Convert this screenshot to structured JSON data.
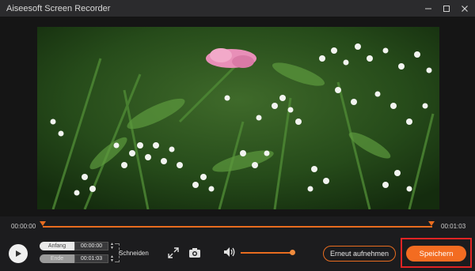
{
  "window": {
    "title": "Aiseesoft Screen Recorder",
    "controls": [
      "minimize-icon",
      "maximize-icon",
      "close-icon"
    ]
  },
  "preview": {
    "description_icon": "video-frame"
  },
  "timeline": {
    "start_time": "00:00:00",
    "end_time": "00:01:03",
    "accent": "#e86c1f"
  },
  "clip": {
    "start_label": "Anfang",
    "start_value": "00:00:00",
    "end_label": "Ende",
    "end_value": "00:01:03",
    "cut_label": "Schneiden"
  },
  "toolbar": {
    "play_icon": "play-icon",
    "expand_icon": "expand-icon",
    "camera_icon": "camera-icon",
    "volume_icon": "volume-icon",
    "volume_level": 0.9
  },
  "actions": {
    "retry_label": "Erneut aufnehmen",
    "save_label": "Speichern",
    "save_color": "#f36c21",
    "highlight_color": "#e02424"
  }
}
